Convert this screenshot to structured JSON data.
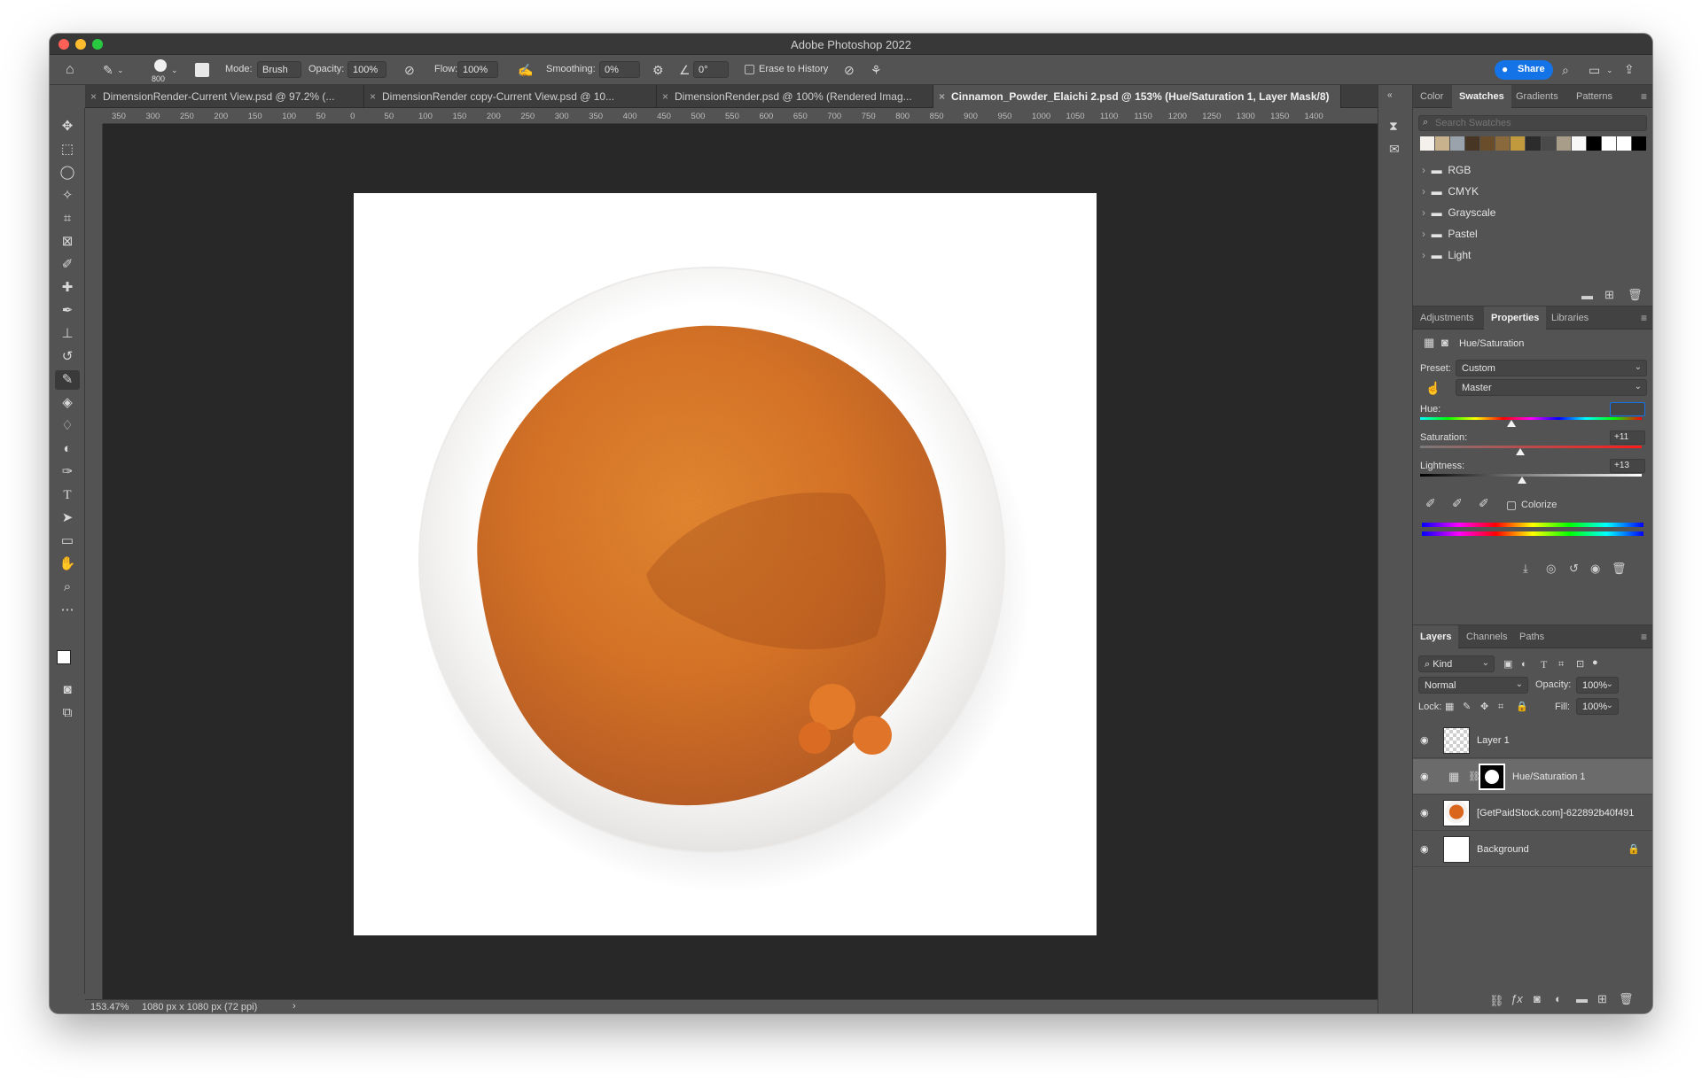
{
  "window": {
    "title": "Adobe Photoshop 2022"
  },
  "options_bar": {
    "brush_size": "800",
    "mode_label": "Mode:",
    "mode_value": "Brush",
    "opacity_label": "Opacity:",
    "opacity_value": "100%",
    "flow_label": "Flow:",
    "flow_value": "100%",
    "smoothing_label": "Smoothing:",
    "smoothing_value": "0%",
    "angle_value": "0°",
    "erase_to_history": "Erase to History",
    "share_label": "Share"
  },
  "tabs": [
    {
      "label": "DimensionRender-Current View.psd @ 97.2% (..."
    },
    {
      "label": "DimensionRender copy-Current View.psd @ 10..."
    },
    {
      "label": "DimensionRender.psd @ 100% (Rendered Imag..."
    },
    {
      "label": "Cinnamon_Powder_Elaichi 2.psd @ 153% (Hue/Saturation 1, Layer Mask/8)"
    }
  ],
  "ruler_ticks": [
    "350",
    "300",
    "250",
    "200",
    "150",
    "100",
    "50",
    "0",
    "50",
    "100",
    "150",
    "200",
    "250",
    "300",
    "350",
    "400",
    "450",
    "500",
    "550",
    "600",
    "650",
    "700",
    "750",
    "800",
    "850",
    "900",
    "950",
    "1000",
    "1050",
    "1100",
    "1150",
    "1200",
    "1250",
    "1300",
    "1350",
    "1400"
  ],
  "status": {
    "zoom": "153.47%",
    "doc_info": "1080 px x 1080 px (72 ppi)"
  },
  "swatches_panel": {
    "tabs": [
      "Color",
      "Swatches",
      "Gradients",
      "Patterns"
    ],
    "active_tab": "Swatches",
    "search_placeholder": "Search Swatches",
    "recent_colors": [
      "#f4f1ec",
      "#c8b28e",
      "#9aa3ab",
      "#463623",
      "#6a4e2c",
      "#8a6a3c",
      "#c09a3c",
      "#2c2c2c",
      "#4a4a4a",
      "#a89d88",
      "#f7f7f7",
      "#000000",
      "#ffffff",
      "#ffffff",
      "#000000"
    ],
    "folders": [
      "RGB",
      "CMYK",
      "Grayscale",
      "Pastel",
      "Light"
    ]
  },
  "properties_panel": {
    "tabs": [
      "Adjustments",
      "Properties",
      "Libraries"
    ],
    "active_tab": "Properties",
    "heading": "Hue/Saturation",
    "preset_label": "Preset:",
    "preset_value": "Custom",
    "channel_value": "Master",
    "hue_label": "Hue:",
    "hue_value": "",
    "saturation_label": "Saturation:",
    "saturation_value": "+11",
    "lightness_label": "Lightness:",
    "lightness_value": "+13",
    "colorize_label": "Colorize"
  },
  "layers_panel": {
    "tabs": [
      "Layers",
      "Channels",
      "Paths"
    ],
    "active_tab": "Layers",
    "filter_kind": "Kind",
    "blend_mode": "Normal",
    "opacity_label": "Opacity:",
    "opacity_value": "100%",
    "lock_label": "Lock:",
    "fill_label": "Fill:",
    "fill_value": "100%",
    "layers": [
      {
        "name": "Layer 1"
      },
      {
        "name": "Hue/Saturation 1"
      },
      {
        "name": "[GetPaidStock.com]-622892b40f491"
      },
      {
        "name": "Background"
      }
    ]
  },
  "colors": {
    "accent": "#1473e6",
    "panel_bg": "#535353",
    "canvas_bg": "#282828",
    "powder": "#e0701c"
  }
}
